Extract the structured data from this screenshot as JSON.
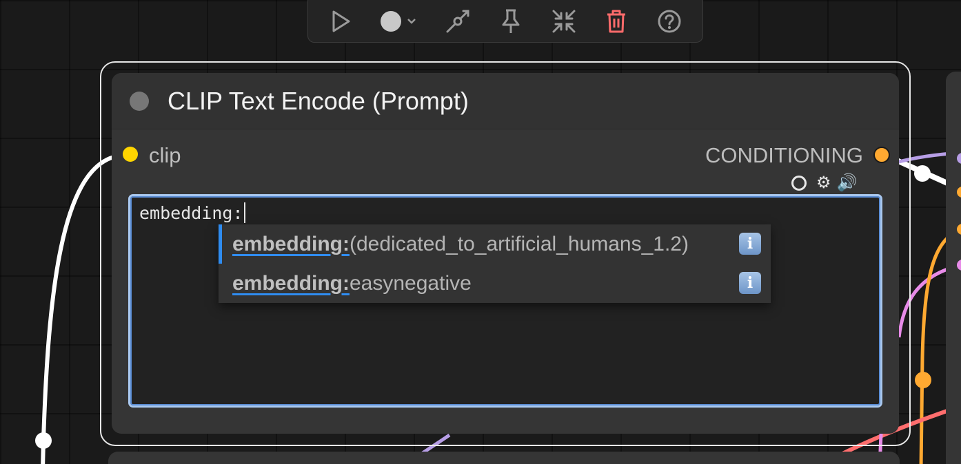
{
  "toolbar": {
    "buttons": [
      "play-icon",
      "color-dot-icon",
      "bypass-icon",
      "pin-icon",
      "collapse-icon",
      "delete-icon",
      "help-icon"
    ],
    "colors": {
      "icon": "#9a9a9a",
      "delete": "#ff6b6b"
    }
  },
  "node": {
    "title": "CLIP Text Encode (Prompt)",
    "input_label": "clip",
    "output_label": "CONDITIONING",
    "prompt_text": "embedding:",
    "colors": {
      "input_slot": "#ffd500",
      "output_slot": "#ffa931",
      "focus": "#a9c8ef"
    }
  },
  "autocomplete": {
    "items": [
      {
        "prefix": "embedding:",
        "rest": "(dedicated_to_artificial_humans_1.2)",
        "info": "i",
        "active": true
      },
      {
        "prefix": "embedding:",
        "rest": "easynegative",
        "info": "i",
        "active": false
      }
    ],
    "accent": "#2f8cf0"
  }
}
